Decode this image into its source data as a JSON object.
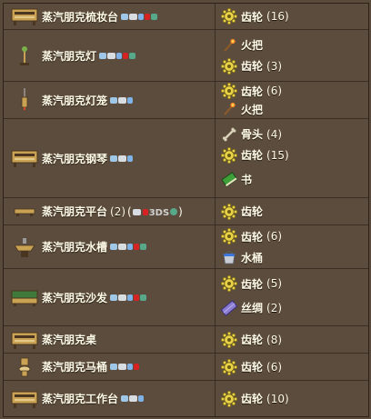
{
  "rows": [
    {
      "name": "蒸汽朋克梳妆台",
      "icon": "dresser-icon",
      "platforms": [
        "pc",
        "console",
        "mobile",
        "old-gen",
        "3ds"
      ],
      "amount": "",
      "extra": "",
      "ingredients": [
        {
          "name": "齿轮",
          "count": "(16)",
          "icon": "cog-icon"
        }
      ]
    },
    {
      "name": "蒸汽朋克灯",
      "icon": "lamp-icon",
      "platforms": [
        "pc",
        "console",
        "mobile",
        "old-gen",
        "3ds"
      ],
      "amount": "",
      "extra": "",
      "ingredients": [
        {
          "name": "火把",
          "count": "",
          "icon": "torch-icon"
        },
        {
          "name": "齿轮",
          "count": "(3)",
          "icon": "cog-icon"
        }
      ]
    },
    {
      "name": "蒸汽朋克灯笼",
      "icon": "lantern-icon",
      "platforms": [
        "pc",
        "console",
        "mobile"
      ],
      "amount": "",
      "extra": "",
      "ingredients": [
        {
          "name": "齿轮",
          "count": "(6)",
          "icon": "cog-icon"
        },
        {
          "name": "火把",
          "count": "",
          "icon": "torch-icon"
        }
      ]
    },
    {
      "name": "蒸汽朋克钢琴",
      "icon": "piano-icon",
      "platforms": [
        "pc",
        "console",
        "mobile"
      ],
      "amount": "",
      "extra": "",
      "ingredients": [
        {
          "name": "骨头",
          "count": "(4)",
          "icon": "bone-icon"
        },
        {
          "name": "齿轮",
          "count": "(15)",
          "icon": "cog-icon"
        },
        {
          "name": "书",
          "count": "",
          "icon": "book-icon"
        }
      ]
    },
    {
      "name": "蒸汽朋克平台",
      "icon": "platform-icon",
      "platforms": [],
      "amount": "(2)",
      "extra": "3DS",
      "ingredients": [
        {
          "name": "齿轮",
          "count": "",
          "icon": "cog-icon"
        }
      ]
    },
    {
      "name": "蒸汽朋克水槽",
      "icon": "sink-icon",
      "platforms": [
        "pc",
        "console",
        "mobile",
        "old-gen",
        "3ds"
      ],
      "amount": "",
      "extra": "",
      "ingredients": [
        {
          "name": "齿轮",
          "count": "(6)",
          "icon": "cog-icon"
        },
        {
          "name": "水桶",
          "count": "",
          "icon": "water-bucket-icon"
        }
      ]
    },
    {
      "name": "蒸汽朋克沙发",
      "icon": "sofa-icon",
      "platforms": [
        "pc",
        "console",
        "mobile",
        "old-gen",
        "3ds"
      ],
      "amount": "",
      "extra": "",
      "ingredients": [
        {
          "name": "齿轮",
          "count": "(5)",
          "icon": "cog-icon"
        },
        {
          "name": "丝绸",
          "count": "(2)",
          "icon": "silk-icon"
        }
      ]
    },
    {
      "name": "蒸汽朋克桌",
      "icon": "table-icon",
      "platforms": [],
      "amount": "",
      "extra": "",
      "ingredients": [
        {
          "name": "齿轮",
          "count": "(8)",
          "icon": "cog-icon"
        }
      ]
    },
    {
      "name": "蒸汽朋克马桶",
      "icon": "toilet-icon",
      "platforms": [
        "pc",
        "console",
        "mobile",
        "old-gen"
      ],
      "amount": "",
      "extra": "",
      "ingredients": [
        {
          "name": "齿轮",
          "count": "(6)",
          "icon": "cog-icon"
        }
      ]
    },
    {
      "name": "蒸汽朋克工作台",
      "icon": "workbench-icon",
      "platforms": [
        "pc",
        "console",
        "mobile"
      ],
      "amount": "",
      "extra": "",
      "ingredients": [
        {
          "name": "齿轮",
          "count": "(10)",
          "icon": "cog-icon"
        }
      ]
    }
  ]
}
